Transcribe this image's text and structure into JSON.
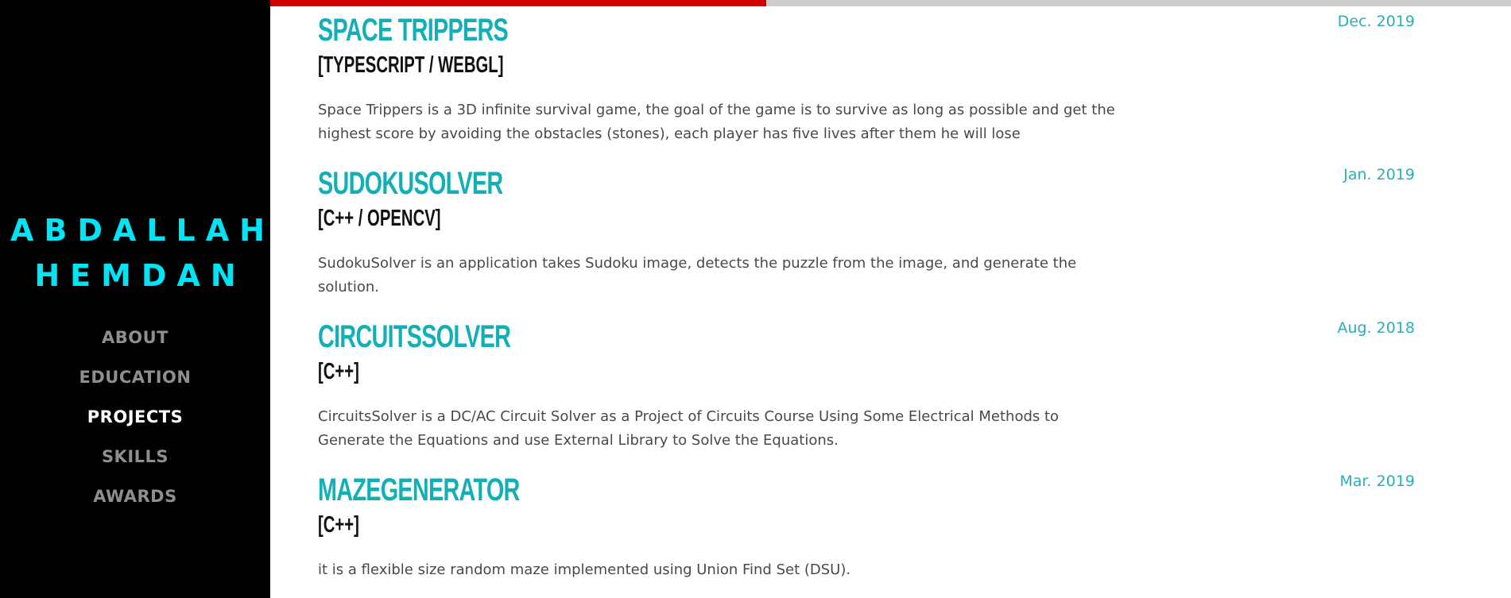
{
  "brand": {
    "line1": "ABDALLAH",
    "line2": "HEMDAN"
  },
  "nav": [
    {
      "label": "ABOUT",
      "active": false
    },
    {
      "label": "EDUCATION",
      "active": false
    },
    {
      "label": "PROJECTS",
      "active": true
    },
    {
      "label": "SKILLS",
      "active": false
    },
    {
      "label": "AWARDS",
      "active": false
    }
  ],
  "progress": {
    "fraction": 0.4
  },
  "colors": {
    "accent": "#12b0b6",
    "brand": "#00e5f5",
    "progress": "#d00000",
    "sidebar": "#000000"
  },
  "projects": [
    {
      "title": "Space Trippers",
      "tech": "[TypeScript / WebGL]",
      "date": "Dec. 2019",
      "description": "Space Trippers is a 3D infinite survival game, the goal of the game is to survive as long as possible and get the highest score by avoiding the obstacles (stones), each player has five lives after them he will lose"
    },
    {
      "title": "SudokuSolver",
      "tech": "[C++ / OpenCV]",
      "date": "Jan. 2019",
      "description": "SudokuSolver is an application takes Sudoku image, detects the puzzle from the image, and generate the solution."
    },
    {
      "title": "CircuitsSolver",
      "tech": "[C++]",
      "date": "Aug. 2018",
      "description": "CircuitsSolver is a DC/AC Circuit Solver as a Project of Circuits Course Using Some Electrical Methods to Generate the Equations and use External Library to Solve the Equations."
    },
    {
      "title": "MazeGenerator",
      "tech": "[C++]",
      "date": "Mar. 2019",
      "description": "it is a flexible size random maze implemented using Union Find Set (DSU)."
    }
  ]
}
